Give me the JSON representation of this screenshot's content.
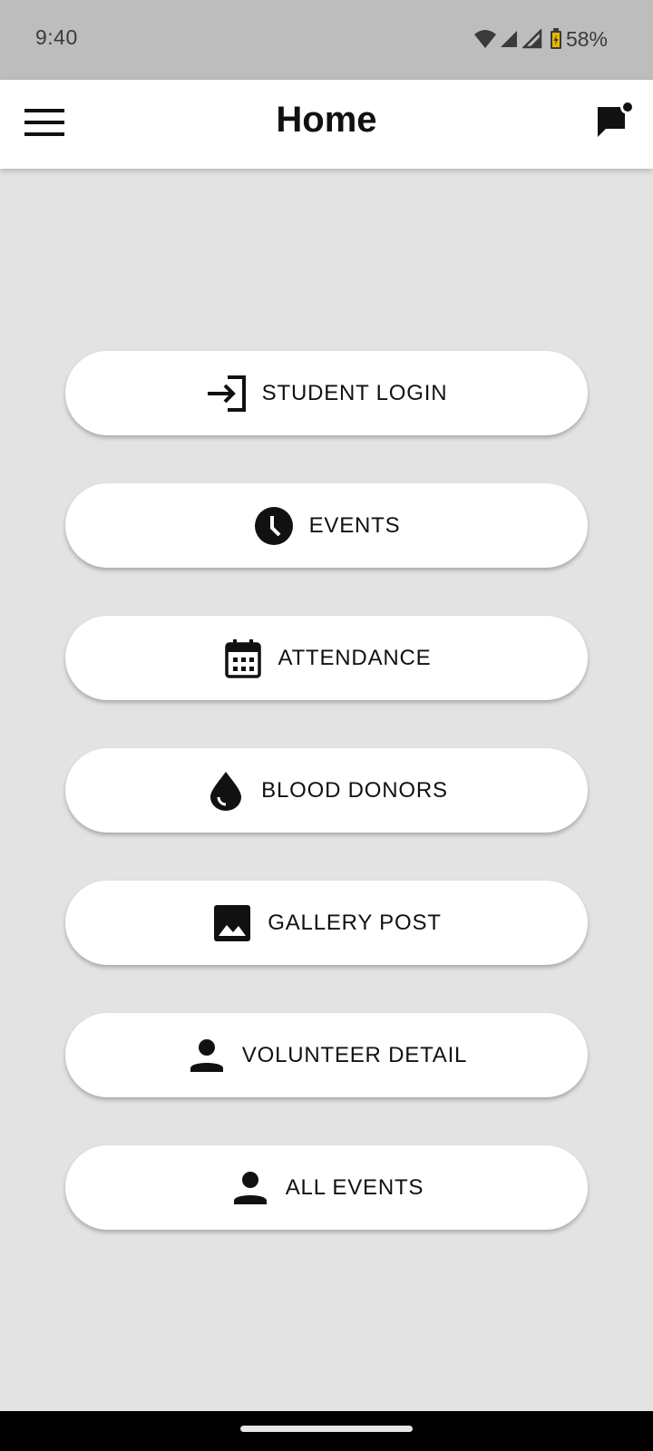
{
  "status_bar": {
    "time": "9:40",
    "battery": "58%",
    "icons": [
      "wifi-icon",
      "signal-icon",
      "signal-icon",
      "battery-charging-icon"
    ]
  },
  "app_bar": {
    "title": "Home",
    "menu_icon": "hamburger-menu-icon",
    "action_icon": "chat-notification-icon"
  },
  "menu": {
    "items": [
      {
        "label": "STUDENT LOGIN",
        "icon": "login-icon"
      },
      {
        "label": "EVENTS",
        "icon": "clock-icon"
      },
      {
        "label": "ATTENDANCE",
        "icon": "calendar-icon"
      },
      {
        "label": "BLOOD DONORS",
        "icon": "blood-drop-icon"
      },
      {
        "label": "GALLERY POST",
        "icon": "image-icon"
      },
      {
        "label": "VOLUNTEER DETAIL",
        "icon": "person-icon"
      },
      {
        "label": "ALL EVENTS",
        "icon": "person-icon"
      }
    ]
  },
  "colors": {
    "background": "#e3e3e3",
    "status_bar": "#bdbdbd",
    "app_bar": "#ffffff",
    "button": "#ffffff",
    "battery_accent": "#e6b800"
  }
}
